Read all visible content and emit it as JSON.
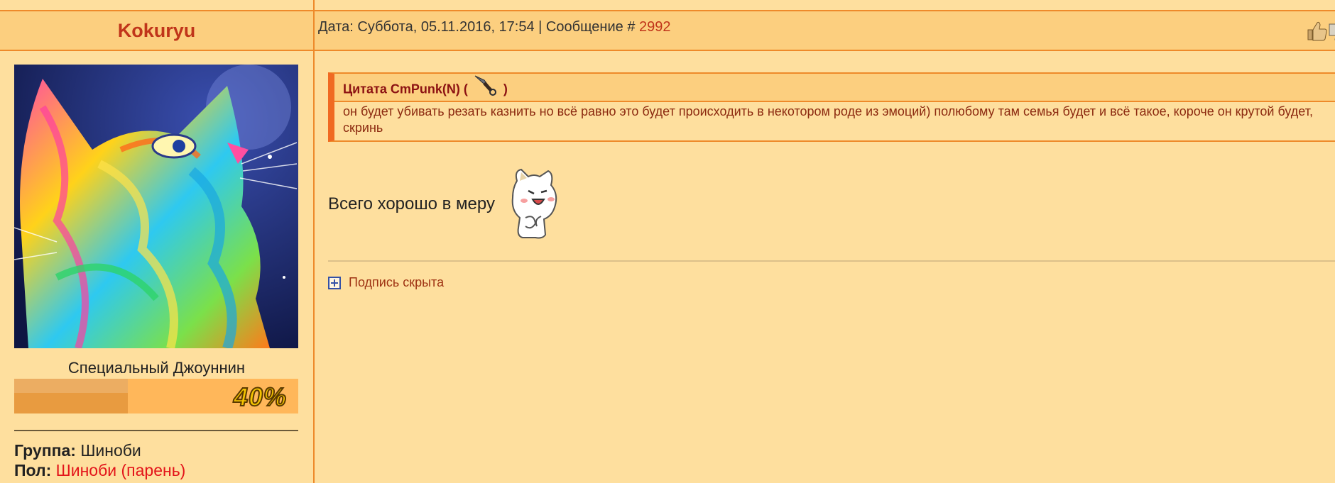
{
  "post": {
    "username": "Kokuryu",
    "date_label": "Дата: Суббота, 05.11.2016, 17:54 | Сообщение #",
    "message_number": "2992"
  },
  "profile": {
    "rank_title": "Специальный Джоуннин",
    "rank_progress_text": "40%",
    "rank_progress_fraction": 0.4,
    "group_label": "Группа:",
    "group_value": "Шиноби",
    "gender_label": "Пол:",
    "gender_value": "Шиноби (парень)"
  },
  "quote": {
    "header_prefix": "Цитата CmPunk(N) (",
    "header_suffix": ")",
    "text": "он будет убивать резать казнить но всё равно это будет происходить в некотором роде из эмоций) полюбому там семья будет и всё такое, короче он крутой будет, скринь"
  },
  "message": {
    "text": "Всего хорошо в меру"
  },
  "signature": {
    "label": "Подпись скрыта"
  },
  "colors": {
    "background": "#FEDF9E",
    "header": "#FCCF7F",
    "border": "#EE8A2A",
    "username": "#C0351A",
    "quote_text": "#8C2A10"
  }
}
